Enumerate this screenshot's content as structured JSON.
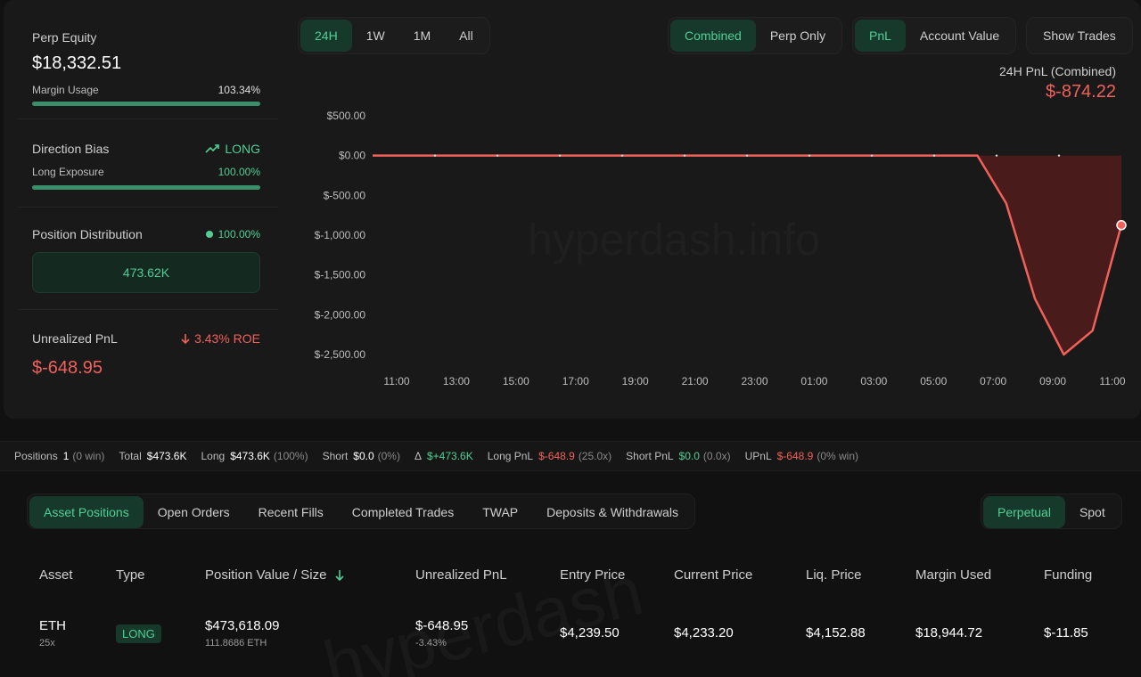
{
  "stats": {
    "perp_equity": {
      "label": "Perp Equity",
      "value": "$18,332.51"
    },
    "margin_usage": {
      "label": "Margin Usage",
      "value": "103.34%",
      "fill": 1.0
    },
    "direction_bias": {
      "label": "Direction Bias",
      "value": "LONG"
    },
    "long_exposure": {
      "label": "Long Exposure",
      "value": "100.00%",
      "fill": 1.0
    },
    "position_distribution": {
      "label": "Position Distribution",
      "value": "100.00%",
      "box": "473.62K"
    },
    "unrealized_pnl": {
      "label": "Unrealized PnL",
      "roe": "3.43% ROE",
      "value": "$-648.95"
    }
  },
  "controls": {
    "time_ranges": [
      "24H",
      "1W",
      "1M",
      "All"
    ],
    "time_active": 0,
    "modes": [
      "Combined",
      "Perp Only"
    ],
    "mode_active": 0,
    "metrics": [
      "PnL",
      "Account Value"
    ],
    "metric_active": 0,
    "show_trades": "Show Trades"
  },
  "pnl_header": {
    "title": "24H PnL (Combined)",
    "value": "$-874.22"
  },
  "watermark": "hyperdash.info",
  "watermark2": "hyperdash",
  "chart_data": {
    "type": "area",
    "x": [
      "11:00",
      "13:00",
      "15:00",
      "17:00",
      "19:00",
      "21:00",
      "23:00",
      "01:00",
      "03:00",
      "05:00",
      "07:00",
      "09:00",
      "11:00"
    ],
    "ytick_labels": [
      "$500.00",
      "$0.00",
      "$-500.00",
      "$-1,000.00",
      "$-1,500.00",
      "$-2,000.00",
      "$-2,500.00"
    ],
    "yticks": [
      500,
      0,
      -500,
      -1000,
      -1500,
      -2000,
      -2500
    ],
    "ylim": [
      -2500,
      500
    ],
    "series": [
      {
        "values": [
          0,
          0,
          0,
          0,
          0,
          0,
          0,
          0,
          0,
          0,
          0,
          0,
          0,
          0,
          0,
          0,
          0,
          0,
          0,
          0,
          0,
          0,
          -600,
          -1800,
          -2500,
          -2200,
          -874.22
        ]
      }
    ],
    "line_color": "#f0615a",
    "fill_color": "#5a1c1c"
  },
  "summary": [
    {
      "label": "Positions",
      "value": "1",
      "extra": "(0 win)",
      "color": "#ffffff"
    },
    {
      "label": "Total",
      "value": "$473.6K",
      "extra": "",
      "color": "#ffffff"
    },
    {
      "label": "Long",
      "value": "$473.6K",
      "extra": "(100%)",
      "color": "#ffffff"
    },
    {
      "label": "Short",
      "value": "$0.0",
      "extra": "(0%)",
      "color": "#ffffff"
    },
    {
      "label": "Δ",
      "value": "$+473.6K",
      "extra": "",
      "color": "#4fcf95"
    },
    {
      "label": "Long PnL",
      "value": "$-648.9",
      "extra": "(25.0x)",
      "color": "#f0615a"
    },
    {
      "label": "Short PnL",
      "value": "$0.0",
      "extra": "(0.0x)",
      "color": "#4fcf95"
    },
    {
      "label": "UPnL",
      "value": "$-648.9",
      "extra": "(0% win)",
      "color": "#f0615a"
    }
  ],
  "tabs": [
    "Asset Positions",
    "Open Orders",
    "Recent Fills",
    "Completed Trades",
    "TWAP",
    "Deposits & Withdrawals"
  ],
  "tab_active": 0,
  "market_tabs": [
    "Perpetual",
    "Spot"
  ],
  "market_active": 0,
  "table": {
    "headers": [
      "Asset",
      "Type",
      "Position Value / Size",
      "Unrealized PnL",
      "Entry Price",
      "Current Price",
      "Liq. Price",
      "Margin Used",
      "Funding"
    ],
    "row": {
      "asset": "ETH",
      "leverage": "25x",
      "type": "LONG",
      "position_value": "$473,618.09",
      "size": "111.8686 ETH",
      "upnl": "$-648.95",
      "upnl_pct": "-3.43%",
      "entry": "$4,239.50",
      "current": "$4,233.20",
      "liq": "$4,152.88",
      "margin": "$18,944.72",
      "funding": "$-11.85"
    }
  }
}
